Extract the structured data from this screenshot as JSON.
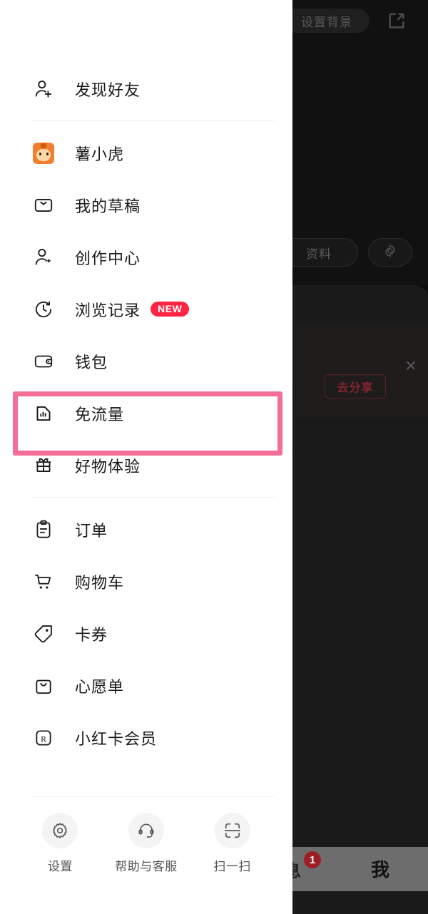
{
  "drawer": {
    "menu_items": [
      {
        "label": "发现好友",
        "icon": "user-plus-icon",
        "badge": null
      },
      {
        "label": "薯小虎",
        "icon": "tiger-avatar-icon",
        "badge": null
      },
      {
        "label": "我的草稿",
        "icon": "inbox-icon",
        "badge": null
      },
      {
        "label": "创作中心",
        "icon": "user-sparkle-icon",
        "badge": null
      },
      {
        "label": "浏览记录",
        "icon": "history-clock-icon",
        "badge": "NEW"
      },
      {
        "label": "钱包",
        "icon": "wallet-icon",
        "badge": null
      },
      {
        "label": "免流量",
        "icon": "sim-card-signal-icon",
        "badge": null
      },
      {
        "label": "好物体验",
        "icon": "gift-icon",
        "badge": null
      },
      {
        "label": "订单",
        "icon": "clipboard-list-icon",
        "badge": null
      },
      {
        "label": "购物车",
        "icon": "shopping-cart-icon",
        "badge": null
      },
      {
        "label": "卡券",
        "icon": "coupon-tag-icon",
        "badge": null
      },
      {
        "label": "心愿单",
        "icon": "wishlist-bag-icon",
        "badge": null
      },
      {
        "label": "小红卡会员",
        "icon": "r-card-membership-icon",
        "badge": null
      }
    ],
    "footer_actions": [
      {
        "label": "设置",
        "icon": "gear-icon"
      },
      {
        "label": "帮助与客服",
        "icon": "headset-icon"
      },
      {
        "label": "扫一扫",
        "icon": "scan-icon"
      }
    ],
    "highlight": {
      "target_label": "免流量",
      "color": "#f56e96"
    }
  },
  "backdrop": {
    "set_background_label": "设置背景",
    "share_icon": "external-link-icon",
    "profile_pill_label": "资料",
    "gear_icon": "gear-icon",
    "share_card": {
      "button_label": "去分享",
      "close_icon": "close-icon"
    },
    "tabbar": {
      "message_tab_label": "息",
      "message_badge": "1",
      "me_tab_label": "我"
    }
  },
  "colors": {
    "accent_red": "#ff2442",
    "highlight_pink": "#f56e96",
    "drawer_bg": "#ffffff",
    "divider": "#f0f0f0"
  }
}
